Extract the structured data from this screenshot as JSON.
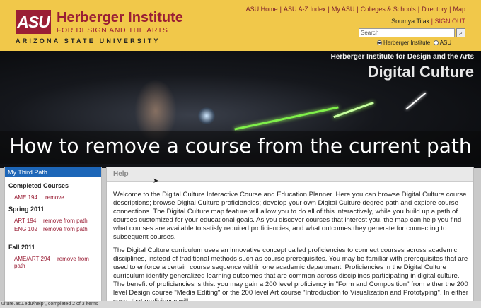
{
  "header": {
    "logo_mark": "ASU",
    "institute_name": "Herberger Institute",
    "institute_sub": "FOR DESIGN AND THE ARTS",
    "university": "ARIZONA STATE UNIVERSITY",
    "top_links": [
      "ASU Home",
      "ASU A-Z Index",
      "My ASU",
      "Colleges & Schools",
      "Directory",
      "Map"
    ],
    "user_name": "Soumya Tilak",
    "sign_out": "SIGN OUT",
    "search_placeholder": "Search",
    "search_button": "⌕",
    "radio_options": [
      "Herberger Institute",
      "ASU"
    ],
    "radio_selected": "Herberger Institute"
  },
  "banner": {
    "tagline": "Herberger Institute for Design and the Arts",
    "title": "Digital Culture"
  },
  "caption": "How to remove a course from the current path",
  "sidebar": {
    "path_title": "My Third Path",
    "sections": [
      {
        "title": "Completed Courses",
        "courses": [
          {
            "code": "AME 194",
            "action": "remove"
          }
        ]
      },
      {
        "title": "Spring 2011",
        "courses": [
          {
            "code": "ART 194",
            "action": "remove from path"
          },
          {
            "code": "ENG 102",
            "action": "remove from path"
          }
        ]
      },
      {
        "title": "Fall 2011",
        "courses": [
          {
            "code": "AME/ART 294",
            "code2": "path",
            "action": "remove from"
          }
        ]
      }
    ]
  },
  "main": {
    "title": "Help",
    "paragraphs": [
      "Welcome to the Digital Culture Interactive Course and Education Planner. Here you can browse Digital Culture course descriptions; browse Digital Culture proficiencies; develop your own Digital Culture degree path and explore course connections. The Digital Culture map feature will allow you to do all of this interactively, while you build up a path of courses customized for your educational goals. As you discover courses that interest you, the map can help you find what courses are available to satisfy required proficiencies, and what outcomes they generate for connecting to subsequent courses.",
      "The Digital Culture curriculum uses an innovative concept called proficiencies to connect courses across academic disciplines, instead of traditional methods such as course prerequisites. You may be familiar with prerequisites that are used to enforce a certain course sequence within one academic department. Proficiencies in the Digital Culture curriculum identify generalized learning outcomes that are common across disciplines participating in digital culture. The benefit of proficiencies is this: you may gain a 200 level proficiency in \"Form and Composition\" from either the 200 level Design course \"Media Editing\" or the 200 level Art course \"Introduction to Visualization and Prototyping\". In either case, that proficiency will"
    ]
  },
  "status_bar": "ulture.asu.edu/help\", completed 2 of 3 items",
  "colors": {
    "maroon": "#9a1e35",
    "gold": "#f1c84a",
    "sidebar_blue": "#1d66b8"
  }
}
